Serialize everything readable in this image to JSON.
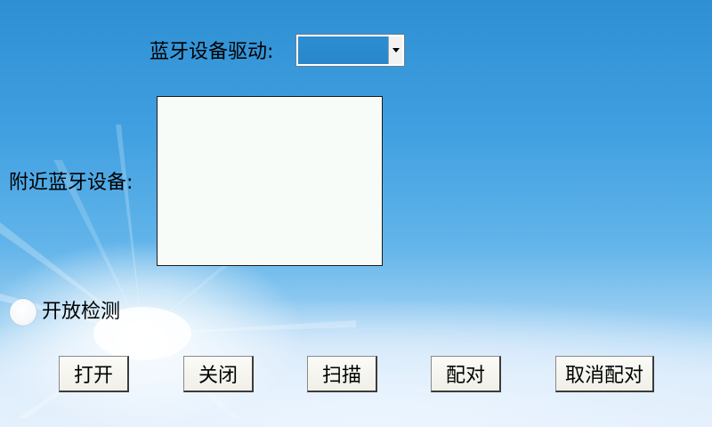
{
  "form": {
    "driver_label": "蓝牙设备驱动:",
    "nearby_label": "附近蓝牙设备:",
    "detect_label": "开放检测",
    "driver_value": "",
    "devices": []
  },
  "buttons": {
    "open": "打开",
    "close": "关闭",
    "scan": "扫描",
    "pair": "配对",
    "unpair": "取消配对"
  },
  "icons": {
    "select_arrow": "chevron-down-icon"
  },
  "colors": {
    "select_bg": "#2b8ed2",
    "button_bg": "#f6f5ef",
    "list_bg": "#f8fcf8"
  }
}
